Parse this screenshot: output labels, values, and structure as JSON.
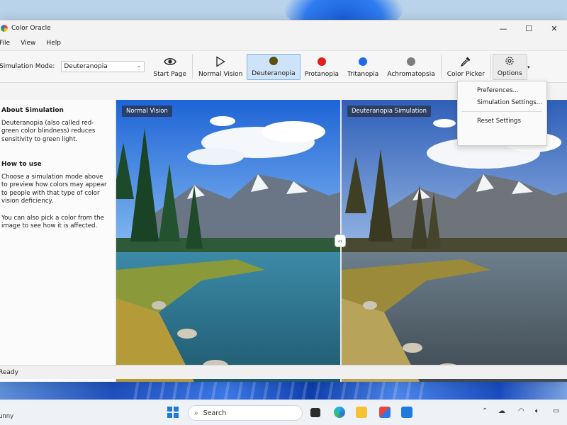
{
  "window": {
    "title": "Color Oracle",
    "controls": {
      "minimize": "—",
      "maximize": "☐",
      "close": "✕"
    }
  },
  "menubar": {
    "items": [
      "File",
      "View",
      "Help"
    ]
  },
  "toolbar": {
    "sim_label": "Simulation Mode:",
    "sim_value": "Deuteranopia",
    "buttons": [
      {
        "label": "Start Page",
        "icon": "eye-icon"
      },
      {
        "label": "Normal Vision",
        "icon": "play-icon"
      },
      {
        "label": "Deuteranopia",
        "icon": "deuteranopia-dot-icon",
        "color": "#5b4e12",
        "active": true
      },
      {
        "label": "Protanopia",
        "icon": "protanopia-dot-icon",
        "color": "#e0201e"
      },
      {
        "label": "Tritanopia",
        "icon": "tritanopia-dot-icon",
        "color": "#1f6ae6"
      },
      {
        "label": "Achromatopsia",
        "icon": "achromatopsia-dot-icon",
        "color": "#7d7d7d"
      },
      {
        "label": "Color Picker",
        "icon": "eyedropper-icon"
      },
      {
        "label": "Options",
        "icon": "gear-icon"
      }
    ]
  },
  "sidebar": {
    "about_heading": "About Simulation",
    "about_text": "Deuteranopia (also called red-green color blindness) reduces sensitivity to green light.",
    "howto_heading": "How to use",
    "howto_text": "Choose a simulation mode above to preview how colors may appear to people with that type of color vision deficiency.",
    "howto_text2": "You can also pick a color from the image to see how it is affected."
  },
  "viewer": {
    "left_label": "Normal Vision",
    "right_label": "Deuteranopia Simulation",
    "handle": "‹›"
  },
  "options_menu": {
    "items": [
      "Preferences...",
      "Simulation Settings...",
      "Reset Settings"
    ]
  },
  "status": {
    "text": "Ready"
  },
  "taskbar": {
    "weather": "unny",
    "search_placeholder": "Search"
  },
  "colors": {
    "accent": "#1f7ae0",
    "active_bg": "#cfe3f8"
  }
}
